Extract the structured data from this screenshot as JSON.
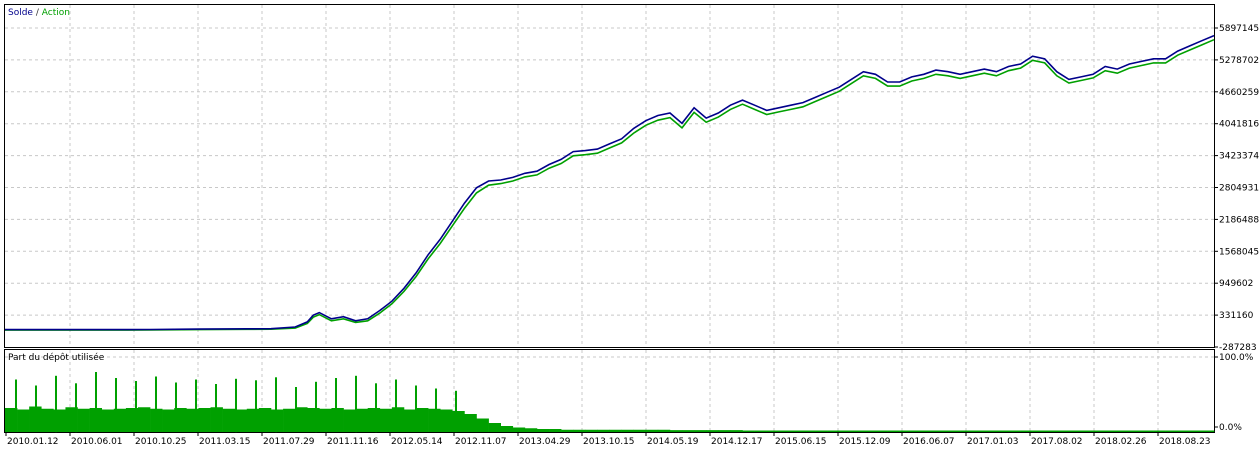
{
  "chart_data": [
    {
      "type": "line",
      "legend": [
        {
          "name": "Solde",
          "color": "#00008b"
        },
        {
          "name": "Action",
          "color": "#00a000"
        }
      ],
      "legend_separator": " / ",
      "y_ticks": [
        "5897145",
        "5278702",
        "4660259",
        "4041816",
        "3423374",
        "2804931",
        "2186488",
        "1568045",
        "949602",
        "331160",
        "-287283"
      ],
      "ylim": [
        -287283,
        5897145
      ],
      "grid": true,
      "series": [
        {
          "name": "Solde",
          "color": "#00008b",
          "x": [
            0,
            4,
            8,
            12,
            16,
            20,
            22,
            24,
            25,
            25.5,
            26,
            27,
            28,
            29,
            30,
            31,
            32,
            33,
            34,
            35,
            36,
            37,
            38,
            39,
            40,
            41,
            42,
            43,
            44,
            45,
            46,
            47,
            48,
            49,
            50,
            51,
            52,
            53,
            54,
            55,
            56,
            57,
            58,
            59,
            60,
            61,
            62,
            63,
            64,
            65,
            66,
            67,
            68,
            69,
            70,
            71,
            72,
            73,
            74,
            75,
            76,
            77,
            78,
            79,
            80,
            81,
            82,
            83,
            84,
            85,
            86,
            87,
            88,
            89,
            90,
            91,
            92,
            93,
            94,
            95,
            96,
            97,
            98,
            99,
            100
          ],
          "values": [
            50000,
            50000,
            50000,
            52000,
            60000,
            65000,
            67000,
            100000,
            200000,
            330000,
            380000,
            260000,
            300000,
            220000,
            260000,
            420000,
            600000,
            850000,
            1150000,
            1500000,
            1800000,
            2150000,
            2500000,
            2800000,
            2930000,
            2950000,
            3000000,
            3080000,
            3120000,
            3250000,
            3350000,
            3500000,
            3520000,
            3550000,
            3650000,
            3750000,
            3950000,
            4100000,
            4200000,
            4250000,
            4050000,
            4350000,
            4150000,
            4250000,
            4400000,
            4500000,
            4400000,
            4300000,
            4350000,
            4400000,
            4450000,
            4550000,
            4650000,
            4750000,
            4900000,
            5050000,
            5000000,
            4850000,
            4850000,
            4950000,
            5000000,
            5080000,
            5050000,
            5000000,
            5050000,
            5100000,
            5050000,
            5150000,
            5200000,
            5350000,
            5300000,
            5050000,
            4900000,
            4950000,
            5000000,
            5150000,
            5100000,
            5200000,
            5250000,
            5300000,
            5300000,
            5450000,
            5550000,
            5650000,
            5750000
          ]
        },
        {
          "name": "Action",
          "color": "#00a000",
          "x": [
            0,
            4,
            8,
            12,
            16,
            20,
            22,
            24,
            25,
            25.5,
            26,
            27,
            28,
            29,
            30,
            31,
            32,
            33,
            34,
            35,
            36,
            37,
            38,
            39,
            40,
            41,
            42,
            43,
            44,
            45,
            46,
            47,
            48,
            49,
            50,
            51,
            52,
            53,
            54,
            55,
            56,
            57,
            58,
            59,
            60,
            61,
            62,
            63,
            64,
            65,
            66,
            67,
            68,
            69,
            70,
            71,
            72,
            73,
            74,
            75,
            76,
            77,
            78,
            79,
            80,
            81,
            82,
            83,
            84,
            85,
            86,
            87,
            88,
            89,
            90,
            91,
            92,
            93,
            94,
            95,
            96,
            97,
            98,
            99,
            100
          ],
          "values": [
            40000,
            40000,
            40000,
            42000,
            50000,
            55000,
            57000,
            80000,
            170000,
            290000,
            340000,
            220000,
            260000,
            190000,
            220000,
            370000,
            550000,
            790000,
            1080000,
            1420000,
            1720000,
            2060000,
            2400000,
            2700000,
            2850000,
            2880000,
            2930000,
            3010000,
            3050000,
            3180000,
            3270000,
            3420000,
            3440000,
            3470000,
            3570000,
            3670000,
            3860000,
            4010000,
            4110000,
            4160000,
            3960000,
            4260000,
            4070000,
            4170000,
            4320000,
            4420000,
            4320000,
            4220000,
            4270000,
            4320000,
            4370000,
            4470000,
            4570000,
            4670000,
            4820000,
            4970000,
            4920000,
            4770000,
            4770000,
            4870000,
            4920000,
            5000000,
            4970000,
            4920000,
            4970000,
            5020000,
            4970000,
            5070000,
            5120000,
            5270000,
            5220000,
            4970000,
            4830000,
            4880000,
            4930000,
            5070000,
            5020000,
            5120000,
            5170000,
            5220000,
            5220000,
            5370000,
            5470000,
            5570000,
            5670000
          ]
        }
      ]
    },
    {
      "type": "bar",
      "title": "Part du dépôt utilisée",
      "y_ticks": [
        "100.0%",
        "0.0%"
      ],
      "ylim": [
        0,
        100
      ],
      "grid": true,
      "color": "#00a000",
      "series": [
        {
          "name": "Part du dépôt utilisée",
          "values": [
            32,
            30,
            34,
            31,
            30,
            33,
            31,
            32,
            30,
            31,
            32,
            33,
            31,
            30,
            32,
            31,
            32,
            33,
            31,
            30,
            31,
            32,
            30,
            31,
            33,
            32,
            31,
            32,
            30,
            31,
            32,
            31,
            33,
            30,
            32,
            31,
            30,
            28,
            24,
            18,
            12,
            8,
            6,
            5,
            4,
            4,
            3,
            3,
            3,
            3,
            3,
            3,
            3,
            3,
            3,
            2.5,
            2.5,
            2.5,
            2.5,
            2.5,
            2.5,
            2,
            2,
            2,
            2,
            2,
            2,
            2,
            2,
            2,
            2,
            2,
            2,
            2,
            2,
            2,
            2,
            2,
            2,
            2,
            2,
            2,
            2,
            2,
            2,
            2,
            2,
            2,
            2,
            2,
            2,
            2,
            2,
            2,
            2,
            2,
            2,
            2,
            2,
            2
          ],
          "spikes": [
            70,
            62,
            75,
            65,
            80,
            72,
            68,
            74,
            66,
            70,
            64,
            71,
            69,
            73,
            60,
            67,
            72,
            75,
            65,
            70,
            62,
            58,
            55
          ]
        }
      ]
    }
  ],
  "x_axis": {
    "tick_labels": [
      "2010.01.12",
      "2010.06.01",
      "2010.10.25",
      "2011.03.15",
      "2011.07.29",
      "2011.11.16",
      "2012.05.14",
      "2012.11.07",
      "2013.04.29",
      "2013.10.15",
      "2014.05.19",
      "2014.12.17",
      "2015.06.15",
      "2015.12.09",
      "2016.06.07",
      "2017.01.03",
      "2017.08.02",
      "2018.02.26",
      "2018.08.23"
    ]
  }
}
